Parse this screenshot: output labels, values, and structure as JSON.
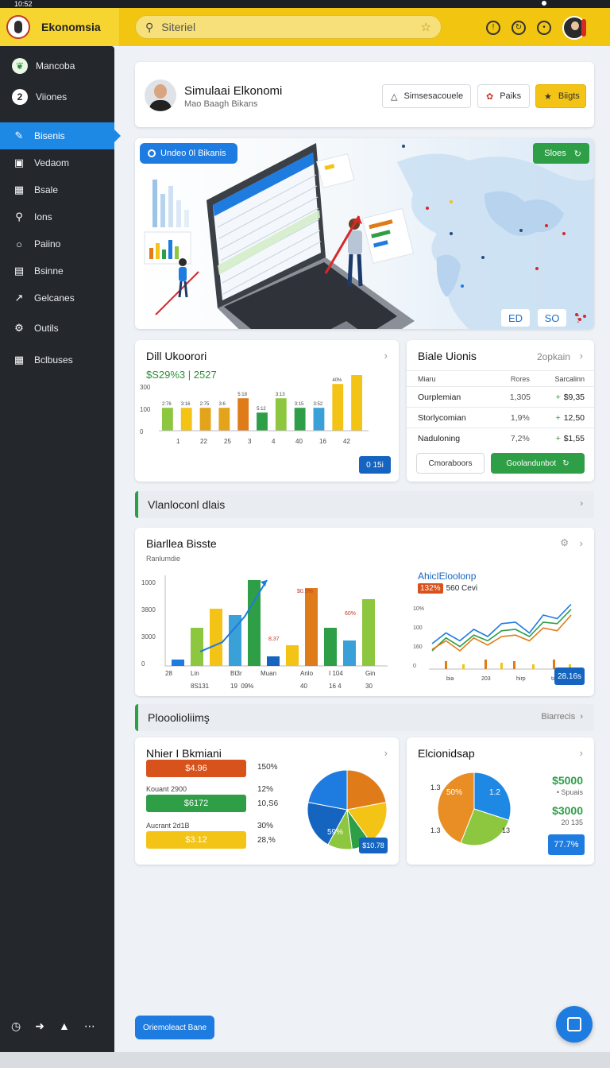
{
  "status": {
    "text": "10:52"
  },
  "app": {
    "name": "Ekonomsia"
  },
  "search": {
    "value": "Siteriel"
  },
  "sidebar": {
    "items": [
      {
        "label": "Mancoba",
        "icon": "leaf-icon"
      },
      {
        "label": "Viiones",
        "icon": "number-two-icon"
      },
      {
        "label": "Bisenis",
        "icon": "pen-icon"
      },
      {
        "label": "Vedaom",
        "icon": "monitor-icon"
      },
      {
        "label": "Bsale",
        "icon": "bag-icon"
      },
      {
        "label": "Ions",
        "icon": "search-icon"
      },
      {
        "label": "Paiino",
        "icon": "chat-icon"
      },
      {
        "label": "Bsinne",
        "icon": "document-icon"
      },
      {
        "label": "Gelcanes",
        "icon": "chart-icon"
      },
      {
        "label": "Outils",
        "icon": "gear-icon"
      },
      {
        "label": "Bclbuses",
        "icon": "calendar-icon"
      }
    ]
  },
  "profile": {
    "title": "Simulaai Elkonomi",
    "subtitle": "Mao Baagh Bikans",
    "buttons": [
      "Simsesacouele",
      "Paiks",
      "Biigts"
    ]
  },
  "hero": {
    "tag": "Undeo 0l Bikanis",
    "button": "Sloes",
    "chips": [
      "ED",
      "SO"
    ]
  },
  "card_daily": {
    "title": "Dill Ukoorori",
    "value": "$S29%3 | 2527",
    "badge": "0 15i",
    "chart_data": {
      "type": "bar",
      "categories": [
        "1",
        "22",
        "25",
        "3",
        "4",
        "40",
        "16",
        "42"
      ],
      "values": [
        48,
        48,
        48,
        48,
        68,
        38,
        68,
        48,
        48,
        98,
        128
      ],
      "y_ticks": [
        "300",
        "100",
        "0"
      ],
      "colors": [
        "#8dc63f",
        "#f3c316",
        "#e3a31a",
        "#e3a31a",
        "#e07b1a",
        "#2e9e47",
        "#8dc63f",
        "#2e9e47",
        "#3aa0d8",
        "#f3c316",
        "#f3c316"
      ],
      "value_labels": [
        "2:76",
        "3:16",
        "2:75",
        "3:6",
        "5:18",
        "5:12",
        "3:13",
        "3:15",
        "3:52",
        "40%"
      ]
    }
  },
  "card_table": {
    "title": "Biale Uionis",
    "link": "2opkain",
    "columns": [
      "Miaru",
      "Rores",
      "Sarcalinn"
    ],
    "rows": [
      {
        "name": "Ourplemian",
        "rate": "1,305",
        "value": "$9,35"
      },
      {
        "name": "Storlycomian",
        "rate": "1,9%",
        "value": "12,50"
      },
      {
        "name": "Naduloning",
        "rate": "7,2%",
        "value": "$1,55"
      }
    ],
    "buttons": [
      "Cmoraboors",
      "Goolandunbot"
    ]
  },
  "section1": {
    "title": "Vlanloconl dlais"
  },
  "card_wide": {
    "title": "Biarllea Bisste",
    "subtitle": "Ranlumdie",
    "chart_data": {
      "type": "bar",
      "y_ticks": [
        "1000",
        "3800",
        "3000",
        "0"
      ],
      "x_ticks": [
        "28",
        "Lin\n8S131",
        "Bt3r\n19  09%",
        "Muan",
        "Anlo\n40",
        "I 104\n16 4",
        "Gin\n30"
      ],
      "bars": [
        8,
        48,
        72,
        64,
        108,
        12,
        26,
        98,
        48,
        32,
        84
      ],
      "bar_colors": [
        "#1e7be0",
        "#8dc63f",
        "#f3c316",
        "#3aa0d8",
        "#2e9e47",
        "#1565c0",
        "#f3c316",
        "#e07b1a",
        "#2e9e47",
        "#3aa0d8",
        "#8dc63f"
      ],
      "trend": [
        38,
        50,
        82,
        128
      ],
      "labels": [
        "$0.5%",
        "8,37",
        "60%"
      ]
    },
    "mini_title": "AhicIEloolonp",
    "mini_value_tag": "132%",
    "mini_value": "560 Cevi",
    "mini_badge": "28.16s",
    "mini_chart": {
      "y_ticks": [
        "10%",
        "100",
        "160",
        "0"
      ],
      "x_ticks": [
        "bia",
        "203",
        "hirp",
        "tap"
      ],
      "series": [
        {
          "name": "blue",
          "color": "#1e7be0",
          "values": [
            40,
            55,
            44,
            60,
            50,
            68,
            70,
            55,
            80,
            75,
            95
          ]
        },
        {
          "name": "green",
          "color": "#2e9e47",
          "values": [
            30,
            48,
            36,
            52,
            44,
            58,
            60,
            50,
            70,
            68,
            88
          ]
        },
        {
          "name": "orange",
          "color": "#e07b1a",
          "values": [
            32,
            44,
            30,
            48,
            38,
            50,
            52,
            44,
            62,
            58,
            80
          ]
        }
      ]
    }
  },
  "section2": {
    "title": "Plooolioliimş",
    "right": "Biarrecis"
  },
  "card_progress": {
    "title": "Nhier I Bkmiani",
    "rows": [
      {
        "label": "",
        "value": "$4.96",
        "color": "#d8521c",
        "pct": "150%"
      },
      {
        "label": "Kouant 2900",
        "value": "$6172",
        "color": "#2e9e47",
        "pct": "12%"
      },
      {
        "label": "Aucrant 2d1B",
        "value": "$3.12",
        "color": "#f3c316",
        "pct": "30%"
      }
    ],
    "extra_pcts": [
      "10,S6",
      "28,%"
    ],
    "pie_badge": "$10.78",
    "pie_label": "59%",
    "pie_data": {
      "type": "pie",
      "values": [
        22,
        18,
        8,
        10,
        20,
        22
      ],
      "colors": [
        "#e07b1a",
        "#f3c316",
        "#2e9e47",
        "#8dc63f",
        "#1565c0",
        "#1e7be0"
      ]
    }
  },
  "card_pie2": {
    "title": "Elcionidsap",
    "big_value_1": "$5000",
    "small_1": "• Spuais",
    "big_value_2": "$3000",
    "small_2": "20 135",
    "badge": "77.7%",
    "pie_labels": [
      "50%",
      "1.2",
      "13",
      "1.3",
      "1.3"
    ],
    "pie_data": {
      "type": "pie",
      "values": [
        30,
        26,
        44
      ],
      "colors": [
        "#1e88e5",
        "#8dc63f",
        "#e88e24"
      ]
    }
  },
  "footer": {
    "button": "Oriemoleact Bane"
  }
}
